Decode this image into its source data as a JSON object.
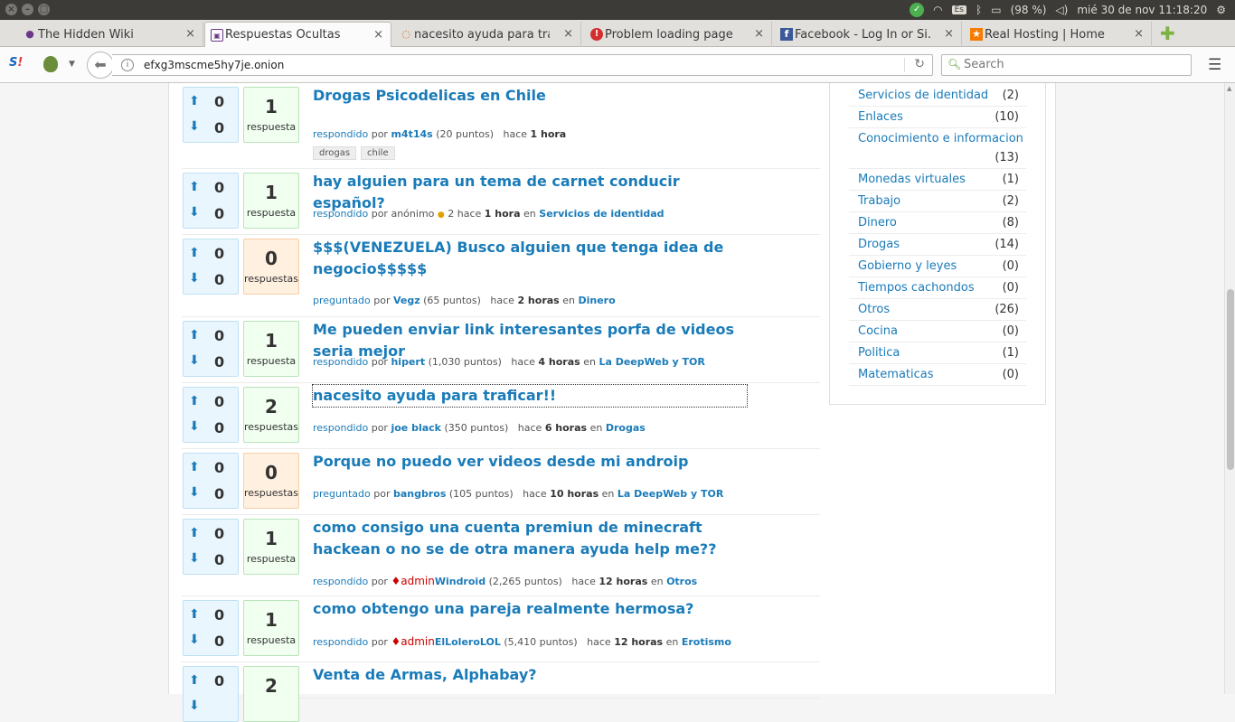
{
  "system": {
    "clock": "mié 30 de nov 11:18:20",
    "battery": "(98 %)",
    "keyboard": "Es"
  },
  "tabs": [
    {
      "title": "The Hidden Wiki",
      "icon": "tor-onion-icon",
      "active": false
    },
    {
      "title": "Respuestas Ocultas",
      "icon": "site-icon",
      "active": true
    },
    {
      "title": "nacesito ayuda para trafic...",
      "icon": "loading-icon",
      "active": false
    },
    {
      "title": "Problem loading page",
      "icon": "error-icon",
      "active": false
    },
    {
      "title": "Facebook - Log In or Si...",
      "icon": "facebook-icon",
      "active": false
    },
    {
      "title": "Real Hosting | Home",
      "icon": "star-icon",
      "active": false
    }
  ],
  "navbar": {
    "url": "efxg3mscme5hy7je.onion",
    "search_placeholder": "Search"
  },
  "questions": [
    {
      "votes_up": "0",
      "votes_down": "0",
      "answers": "1",
      "answers_label": "respuesta",
      "title": "Drogas Psicodelicas en Chile",
      "action": "respondido",
      "por": "por",
      "user": "m4t14s",
      "points": "(20 puntos)",
      "ago_prefix": "hace",
      "ago": "1 hora",
      "en": "",
      "category": "",
      "tags": [
        "drogas",
        "chile"
      ]
    },
    {
      "votes_up": "0",
      "votes_down": "0",
      "answers": "1",
      "answers_label": "respuesta",
      "title": "hay alguien para un tema de carnet conducir español?",
      "action": "respondido",
      "por": "por",
      "user_anon": "anónimo",
      "points_anon": "2",
      "ago_prefix": "hace",
      "ago": "1 hora",
      "en": "en",
      "category": "Servicios de identidad"
    },
    {
      "votes_up": "0",
      "votes_down": "0",
      "answers": "0",
      "answers_label": "respuestas",
      "title": "$$$(VENEZUELA) Busco alguien que tenga idea de negocio$$$$$",
      "action": "preguntado",
      "por": "por",
      "user": "Vegz",
      "points": "(65 puntos)",
      "ago_prefix": "hace",
      "ago": "2 horas",
      "en": "en",
      "category": "Dinero"
    },
    {
      "votes_up": "0",
      "votes_down": "0",
      "answers": "1",
      "answers_label": "respuesta",
      "title": "Me pueden enviar link interesantes porfa de videos seria mejor",
      "action": "respondido",
      "por": "por",
      "user": "hipert",
      "points": "(1,030 puntos)",
      "ago_prefix": "hace",
      "ago": "4 horas",
      "en": "en",
      "category": "La DeepWeb y TOR"
    },
    {
      "votes_up": "0",
      "votes_down": "0",
      "answers": "2",
      "answers_label": "respuestas",
      "title": "nacesito ayuda para traficar!!",
      "action": "respondido",
      "por": "por",
      "user": "joe black",
      "points": "(350 puntos)",
      "ago_prefix": "hace",
      "ago": "6 horas",
      "en": "en",
      "category": "Drogas"
    },
    {
      "votes_up": "0",
      "votes_down": "0",
      "answers": "0",
      "answers_label": "respuestas",
      "title": "Porque no puedo ver videos desde mi androip",
      "action": "preguntado",
      "por": "por",
      "user": "bangbros",
      "points": "(105 puntos)",
      "ago_prefix": "hace",
      "ago": "10 horas",
      "en": "en",
      "category": "La DeepWeb y TOR"
    },
    {
      "votes_up": "0",
      "votes_down": "0",
      "answers": "1",
      "answers_label": "respuesta",
      "title": "como consigo una cuenta premiun de minecraft hackean o no se de otra manera ayuda help me??",
      "action": "respondido",
      "por": "por",
      "badge": "♦admin",
      "user": "Windroid",
      "points": "(2,265 puntos)",
      "ago_prefix": "hace",
      "ago": "12 horas",
      "en": "en",
      "category": "Otros"
    },
    {
      "votes_up": "0",
      "votes_down": "0",
      "answers": "1",
      "answers_label": "respuesta",
      "title": "como obtengo una pareja realmente hermosa?",
      "action": "respondido",
      "por": "por",
      "badge": "♦admin",
      "user": "ElLoleroLOL",
      "points": "(5,410 puntos)",
      "ago_prefix": "hace",
      "ago": "12 horas",
      "en": "en",
      "category": "Erotismo"
    },
    {
      "votes_up": "0",
      "votes_down": "",
      "answers": "2",
      "answers_label": "",
      "title": "Venta de Armas, Alphabay?"
    }
  ],
  "categories": [
    {
      "name": "Servicios de identidad",
      "count": "(2)"
    },
    {
      "name": "Enlaces",
      "count": "(10)"
    },
    {
      "name": "Conocimiento e informacion",
      "count": "(13)"
    },
    {
      "name": "Monedas virtuales",
      "count": "(1)"
    },
    {
      "name": "Trabajo",
      "count": "(2)"
    },
    {
      "name": "Dinero",
      "count": "(8)"
    },
    {
      "name": "Drogas",
      "count": "(14)"
    },
    {
      "name": "Gobierno y leyes",
      "count": "(0)"
    },
    {
      "name": "Tiempos cachondos",
      "count": "(0)"
    },
    {
      "name": "Otros",
      "count": "(26)"
    },
    {
      "name": "Cocina",
      "count": "(0)"
    },
    {
      "name": "Politica",
      "count": "(1)"
    },
    {
      "name": "Matematicas",
      "count": "(0)"
    }
  ]
}
